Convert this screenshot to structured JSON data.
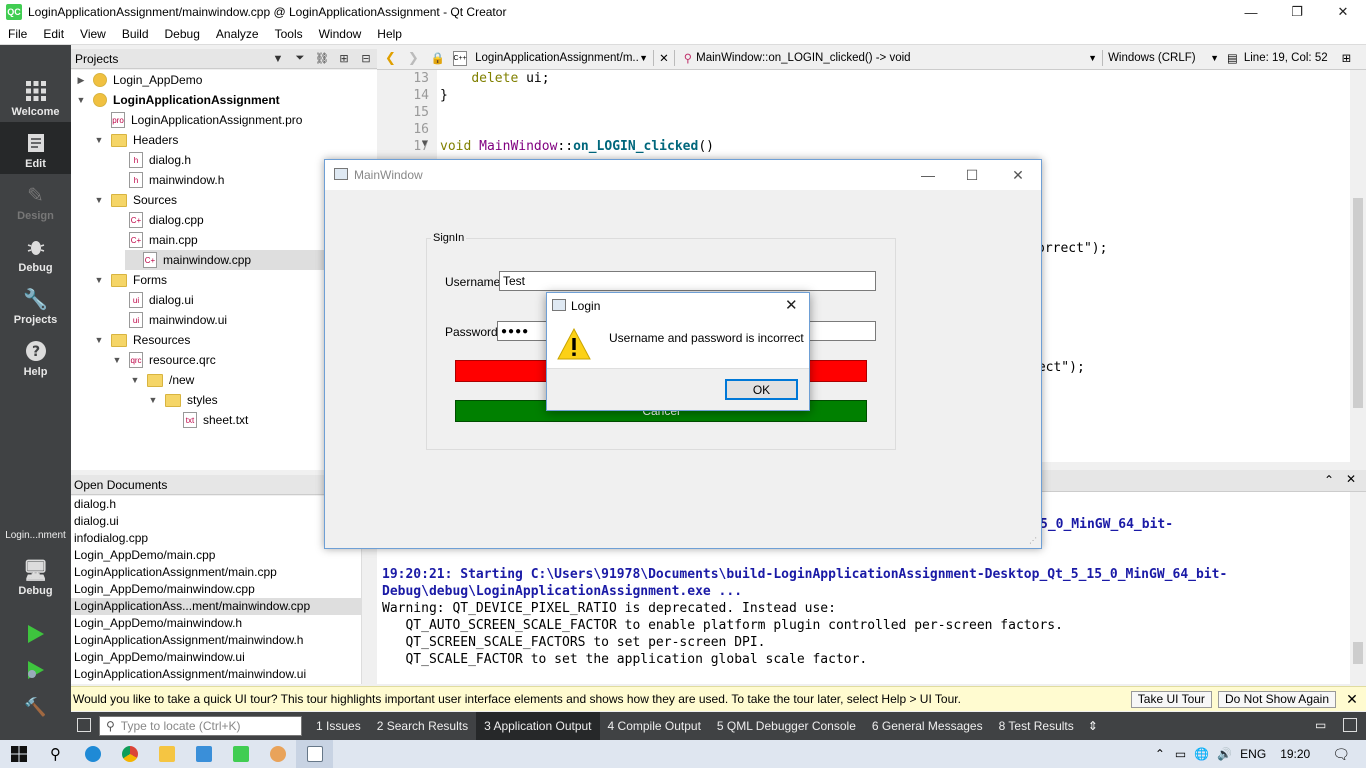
{
  "window": {
    "title": "LoginApplicationAssignment/mainwindow.cpp @ LoginApplicationAssignment - Qt Creator",
    "app_icon": "QC"
  },
  "menu": [
    "File",
    "Edit",
    "View",
    "Build",
    "Debug",
    "Analyze",
    "Tools",
    "Window",
    "Help"
  ],
  "modes": [
    {
      "label": "Welcome",
      "icon": "grid-icon"
    },
    {
      "label": "Edit",
      "icon": "edit-icon"
    },
    {
      "label": "Design",
      "icon": "pen-icon"
    },
    {
      "label": "Debug",
      "icon": "bug-icon"
    },
    {
      "label": "Projects",
      "icon": "wrench-icon"
    },
    {
      "label": "Help",
      "icon": "help-icon"
    }
  ],
  "target": {
    "project": "Login...nment",
    "label": "Debug"
  },
  "projects": {
    "header": "Projects",
    "tree": [
      {
        "label": "Login_AppDemo",
        "depth": 0,
        "arrow": "▶",
        "icon": "project"
      },
      {
        "label": "LoginApplicationAssignment",
        "depth": 0,
        "arrow": "▼",
        "icon": "project",
        "bold": true
      },
      {
        "label": "LoginApplicationAssignment.pro",
        "depth": 1,
        "arrow": "",
        "icon": "pro"
      },
      {
        "label": "Headers",
        "depth": 1,
        "arrow": "▼",
        "icon": "folder-h"
      },
      {
        "label": "dialog.h",
        "depth": 2,
        "arrow": "",
        "icon": "h"
      },
      {
        "label": "mainwindow.h",
        "depth": 2,
        "arrow": "",
        "icon": "h"
      },
      {
        "label": "Sources",
        "depth": 1,
        "arrow": "▼",
        "icon": "folder-c"
      },
      {
        "label": "dialog.cpp",
        "depth": 2,
        "arrow": "",
        "icon": "cpp"
      },
      {
        "label": "main.cpp",
        "depth": 2,
        "arrow": "",
        "icon": "cpp"
      },
      {
        "label": "mainwindow.cpp",
        "depth": 2,
        "arrow": "",
        "icon": "cpp",
        "selected": true
      },
      {
        "label": "Forms",
        "depth": 1,
        "arrow": "▼",
        "icon": "folder-f"
      },
      {
        "label": "dialog.ui",
        "depth": 2,
        "arrow": "",
        "icon": "ui"
      },
      {
        "label": "mainwindow.ui",
        "depth": 2,
        "arrow": "",
        "icon": "ui"
      },
      {
        "label": "Resources",
        "depth": 1,
        "arrow": "▼",
        "icon": "folder-r"
      },
      {
        "label": "resource.qrc",
        "depth": 2,
        "arrow": "▼",
        "icon": "qrc"
      },
      {
        "label": "/new",
        "depth": 3,
        "arrow": "▼",
        "icon": "folder"
      },
      {
        "label": "styles",
        "depth": 4,
        "arrow": "▼",
        "icon": "folder"
      },
      {
        "label": "sheet.txt",
        "depth": 5,
        "arrow": "",
        "icon": "txt"
      }
    ]
  },
  "open_documents": {
    "header": "Open Documents",
    "items": [
      "dialog.h",
      "dialog.ui",
      "infodialog.cpp",
      "Login_AppDemo/main.cpp",
      "LoginApplicationAssignment/main.cpp",
      "Login_AppDemo/mainwindow.cpp",
      "LoginApplicationAss...ment/mainwindow.cpp",
      "Login_AppDemo/mainwindow.h",
      "LoginApplicationAssignment/mainwindow.h",
      "Login_AppDemo/mainwindow.ui",
      "LoginApplicationAssignment/mainwindow.ui"
    ],
    "selected_index": 6
  },
  "editor_toolbar": {
    "file": "LoginApplicationAssignment/m...",
    "symbol": "MainWindow::on_LOGIN_clicked() -> void",
    "line_endings": "Windows (CRLF)",
    "position": "Line: 19, Col: 52"
  },
  "editor": {
    "lines": [
      {
        "num": "13",
        "code": "    delete ui;"
      },
      {
        "num": "14",
        "code": "}"
      },
      {
        "num": "15",
        "code": ""
      },
      {
        "num": "16",
        "code": ""
      },
      {
        "num": "17",
        "code": "void MainWindow::on_LOGIN_clicked()"
      }
    ],
    "frag1": "orrect\");",
    "frag2": "rect\");"
  },
  "output": {
    "frag_top": "5_0_MinGW_64_bit-",
    "start_line1": "19:20:21: Starting C:\\Users\\91978\\Documents\\build-LoginApplicationAssignment-Desktop_Qt_5_15_0_MinGW_64_bit-",
    "start_line2": "Debug\\debug\\LoginApplicationAssignment.exe ...",
    "warn": [
      "Warning: QT_DEVICE_PIXEL_RATIO is deprecated. Instead use:",
      "   QT_AUTO_SCREEN_SCALE_FACTOR to enable platform plugin controlled per-screen factors.",
      "   QT_SCREEN_SCALE_FACTORS to set per-screen DPI.",
      "   QT_SCALE_FACTOR to set the application global scale factor."
    ]
  },
  "infobar": {
    "message": "Would you like to take a quick UI tour? This tour highlights important user interface elements and shows how they are used. To take the tour later, select Help > UI Tour.",
    "tour_button": "Take UI Tour",
    "dismiss_button": "Do Not Show Again"
  },
  "panebar": {
    "locator_placeholder": "Type to locate (Ctrl+K)",
    "tabs": [
      "1  Issues",
      "2  Search Results",
      "3  Application Output",
      "4  Compile Output",
      "5  QML Debugger Console",
      "6  General Messages",
      "8  Test Results"
    ],
    "active_tab": 2
  },
  "mainwindow": {
    "title": "MainWindow",
    "group": "SignIn",
    "username_label": "Username",
    "username_value": "Test",
    "password_label": "Password",
    "password_value": "●●●●",
    "cancel_label": "Cancel"
  },
  "msgbox": {
    "title": "Login",
    "text": "Username and password is incorrect",
    "ok": "OK"
  },
  "taskbar": {
    "lang": "ENG",
    "time": "19:20"
  }
}
